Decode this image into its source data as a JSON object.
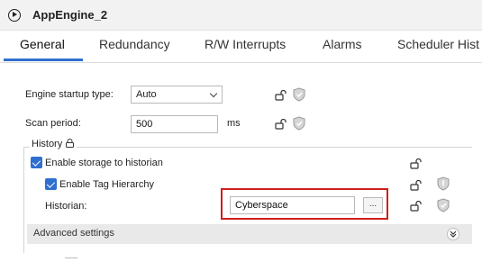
{
  "window": {
    "title": "AppEngine_2"
  },
  "tabs": [
    {
      "label": "General",
      "active": true
    },
    {
      "label": "Redundancy"
    },
    {
      "label": "R/W Interrupts"
    },
    {
      "label": "Alarms"
    },
    {
      "label": "Scheduler Hist"
    }
  ],
  "general": {
    "engine_startup_type": {
      "label": "Engine startup type:",
      "value": "Auto"
    },
    "scan_period": {
      "label": "Scan period:",
      "value": "500",
      "unit": "ms"
    }
  },
  "history": {
    "title": "History",
    "enable_storage": {
      "label": "Enable storage to historian",
      "checked": true
    },
    "enable_tag_hierarchy": {
      "label": "Enable Tag Hierarchy",
      "checked": true
    },
    "historian": {
      "label": "Historian:",
      "value": "Cyberspace",
      "browse_label": "..."
    },
    "advanced": {
      "label": "Advanced settings"
    }
  },
  "colors": {
    "accent": "#2f6fd0",
    "highlight": "#d01f1f"
  }
}
